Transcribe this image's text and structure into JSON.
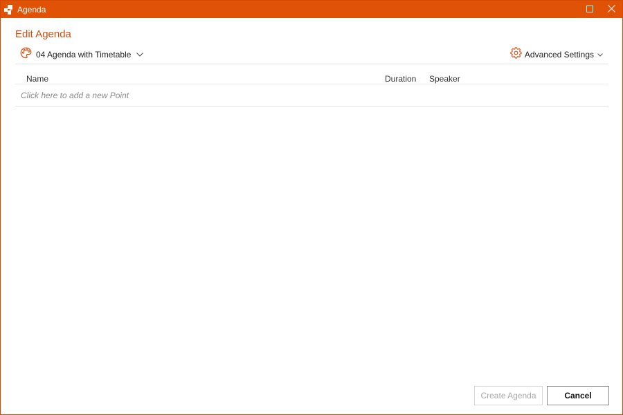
{
  "window": {
    "title": "Agenda",
    "accent_color": "#e05206",
    "icons": {
      "app": "app-logo-icon",
      "maximize": "maximize-icon",
      "close": "close-icon"
    }
  },
  "editor": {
    "heading": "Edit Agenda",
    "theme_selector": {
      "icon": "palette-icon",
      "selected": "04 Agenda with Timetable"
    },
    "advanced_settings": {
      "icon": "gear-icon",
      "label": "Advanced Settings"
    }
  },
  "table": {
    "columns": [
      "Name",
      "Duration",
      "Speaker"
    ],
    "placeholder_row": "Click here to add a new Point"
  },
  "footer": {
    "create_label": "Create Agenda",
    "cancel_label": "Cancel"
  }
}
